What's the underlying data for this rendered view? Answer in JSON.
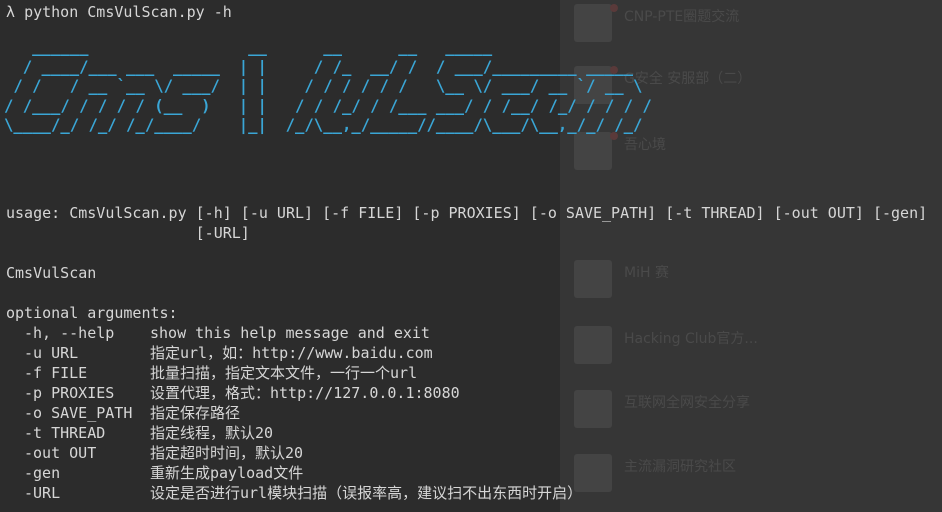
{
  "terminal": {
    "prompt_symbol": "λ",
    "command": "python CmsVulScan.py -h",
    "banner_ascii": "   ______                 __      __      __   _____\n  / ____/___ ___  _____  | |     / /_  __/ /  / ___/_________ _____\n / /   / __ `__ \\/ ___/  | |    / / / / / /   \\__ \\/ ___/ __ `/ __ \\\n/ /___/ / / / / (__  )   | |   / / /_/ / /___ ___/ / /__/ /_/ / / / /\n\\____/_/ /_/ /_/____/    |_|  /_/\\__,_/_____//____/\\___/\\__,_/_/ /_/",
    "usage_line1": "usage: CmsVulScan.py [-h] [-u URL] [-f FILE] [-p PROXIES] [-o SAVE_PATH] [-t THREAD] [-out OUT] [-gen]",
    "usage_line2": "                     [-URL]",
    "program_name": "CmsVulScan",
    "section_header": "optional arguments:",
    "options": [
      {
        "flag": "-h, --help",
        "desc": "show this help message and exit"
      },
      {
        "flag": "-u URL",
        "desc": "指定url，如：http://www.baidu.com"
      },
      {
        "flag": "-f FILE",
        "desc": "批量扫描，指定文本文件，一行一个url"
      },
      {
        "flag": "-p PROXIES",
        "desc": "设置代理，格式：http://127.0.0.1:8080"
      },
      {
        "flag": "-o SAVE_PATH",
        "desc": "指定保存路径"
      },
      {
        "flag": "-t THREAD",
        "desc": "指定线程，默认20"
      },
      {
        "flag": "-out OUT",
        "desc": "指定超时时间，默认20"
      },
      {
        "flag": "-gen",
        "desc": "重新生成payload文件"
      },
      {
        "flag": "-URL",
        "desc": "设定是否进行url模块扫描（误报率高，建议扫不出东西时开启）"
      }
    ]
  },
  "background_window": {
    "items": [
      {
        "title": "CNP-PTE圈题交流"
      },
      {
        "title": "G安全 安服部（二）"
      },
      {
        "title": "吾心境"
      },
      {
        "title": "MiH 赛"
      },
      {
        "title": "Hacking Club官方..."
      },
      {
        "title": "互联网全网安全分享"
      },
      {
        "title": "主流漏洞研究社区"
      }
    ]
  },
  "colors": {
    "terminal_bg": "#2c2c2c",
    "text": "#d6d6d6",
    "banner": "#3aa6d6"
  }
}
